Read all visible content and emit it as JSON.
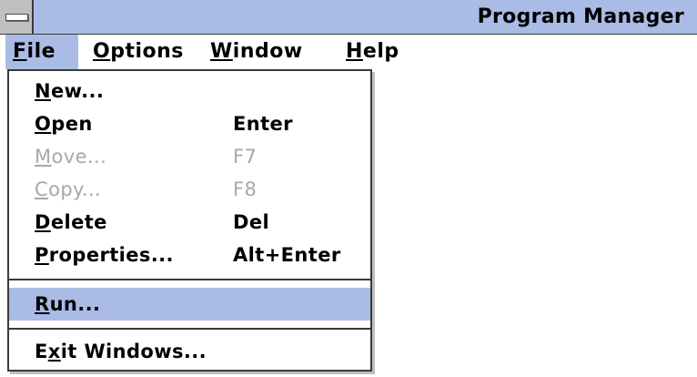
{
  "window": {
    "title": "Program Manager"
  },
  "menubar": {
    "items": [
      {
        "prefix": "",
        "accel": "F",
        "suffix": "ile"
      },
      {
        "prefix": "",
        "accel": "O",
        "suffix": "ptions"
      },
      {
        "prefix": "",
        "accel": "W",
        "suffix": "indow"
      },
      {
        "prefix": "",
        "accel": "H",
        "suffix": "elp"
      }
    ]
  },
  "file_menu": {
    "items": [
      {
        "prefix": "",
        "accel": "N",
        "suffix": "ew...",
        "shortcut": ""
      },
      {
        "prefix": "",
        "accel": "O",
        "suffix": "pen",
        "shortcut": "Enter"
      },
      {
        "prefix": "",
        "accel": "M",
        "suffix": "ove...",
        "shortcut": "F7"
      },
      {
        "prefix": "",
        "accel": "C",
        "suffix": "opy...",
        "shortcut": "F8"
      },
      {
        "prefix": "",
        "accel": "D",
        "suffix": "elete",
        "shortcut": "Del"
      },
      {
        "prefix": "",
        "accel": "P",
        "suffix": "roperties...",
        "shortcut": "Alt+Enter"
      },
      {
        "prefix": "",
        "accel": "R",
        "suffix": "un...",
        "shortcut": ""
      },
      {
        "prefix": "E",
        "accel": "x",
        "suffix": "it Windows...",
        "shortcut": ""
      }
    ]
  },
  "colors": {
    "highlight": "#aabbe6",
    "disabled_text": "#a8a8a8"
  }
}
